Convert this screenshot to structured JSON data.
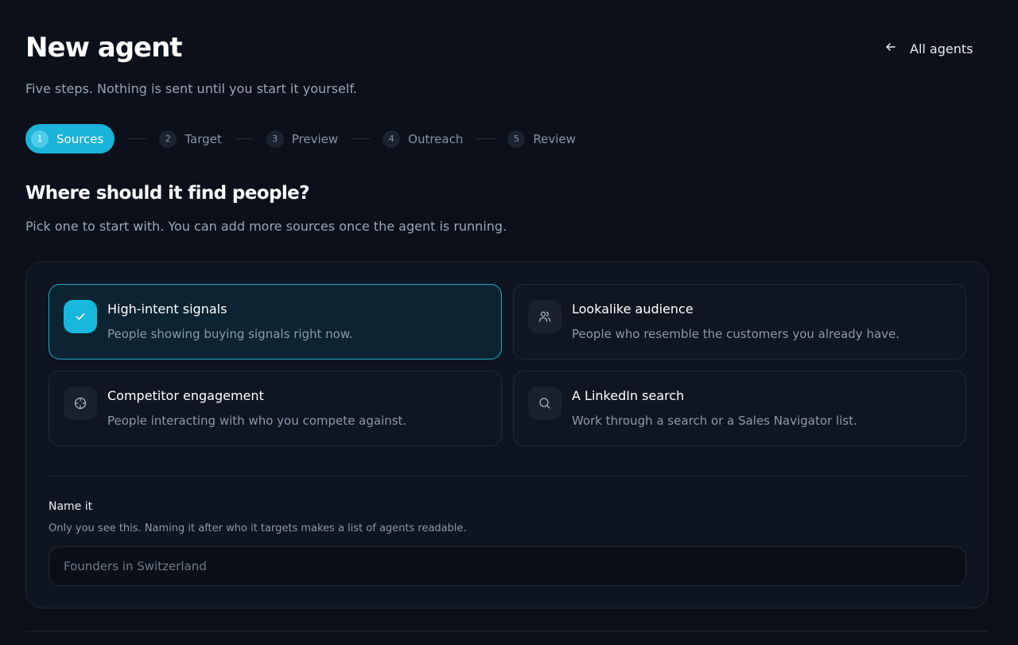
{
  "header": {
    "title": "New agent",
    "subtitle": "Five steps. Nothing is sent until you start it yourself.",
    "back_label": "All agents"
  },
  "stepper": {
    "steps": [
      {
        "num": "1",
        "label": "Sources",
        "active": true
      },
      {
        "num": "2",
        "label": "Target",
        "active": false
      },
      {
        "num": "3",
        "label": "Preview",
        "active": false
      },
      {
        "num": "4",
        "label": "Outreach",
        "active": false
      },
      {
        "num": "5",
        "label": "Review",
        "active": false
      }
    ]
  },
  "section": {
    "title": "Where should it find people?",
    "subtitle": "Pick one to start with. You can add more sources once the agent is running."
  },
  "options": [
    {
      "title": "High-intent signals",
      "desc": "People showing buying signals right now.",
      "icon": "check-icon",
      "selected": true
    },
    {
      "title": "Lookalike audience",
      "desc": "People who resemble the customers you already have.",
      "icon": "users-icon",
      "selected": false
    },
    {
      "title": "Competitor engagement",
      "desc": "People interacting with who you compete against.",
      "icon": "crosshair-icon",
      "selected": false
    },
    {
      "title": "A LinkedIn search",
      "desc": "Work through a search or a Sales Navigator list.",
      "icon": "search-icon",
      "selected": false
    }
  ],
  "name_field": {
    "label": "Name it",
    "help": "Only you see this. Naming it after who it targets makes a list of agents readable.",
    "placeholder": "Founders in Switzerland",
    "value": ""
  },
  "colors": {
    "background": "#0b101a",
    "accent": "#1ab3d9",
    "selected_border": "#1fa6c7",
    "muted_text": "#8c98a9"
  }
}
